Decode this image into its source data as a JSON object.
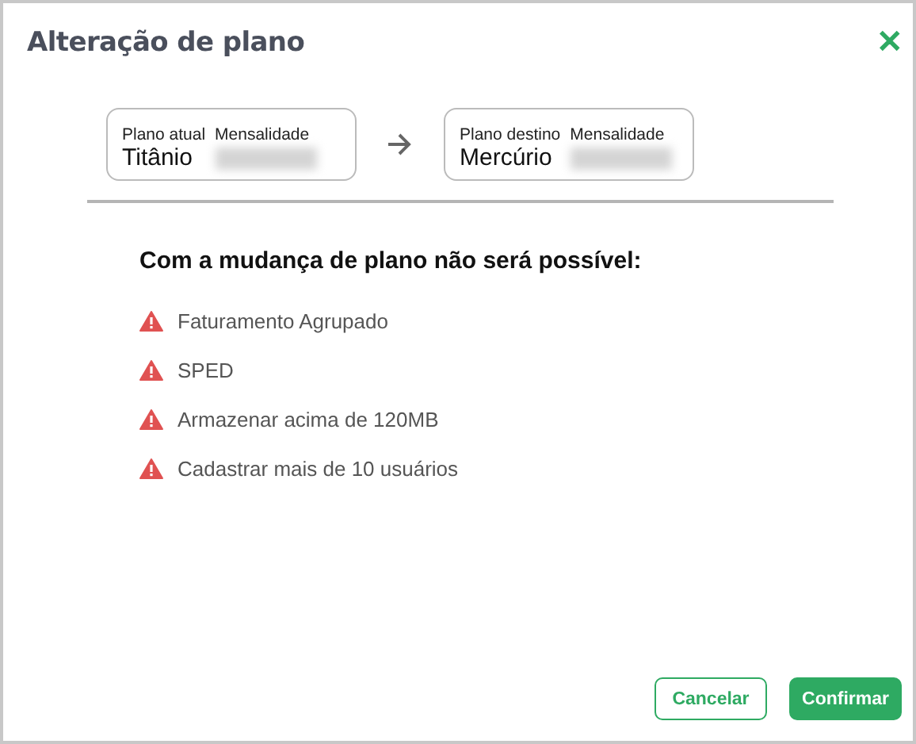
{
  "dialog": {
    "title": "Alteração de plano",
    "close": "✕"
  },
  "plans": [
    {
      "label": "Plano atual",
      "name": "Titânio",
      "price_label": "Mensalidade"
    },
    {
      "label": "Plano destino",
      "name": "Mercúrio",
      "price_label": "Mensalidade"
    }
  ],
  "warning": {
    "heading": "Com a mudança de plano não será possível:",
    "items": [
      "Faturamento Agrupado",
      "SPED",
      "Armazenar acima de 120MB",
      "Cadastrar mais de 10 usuários"
    ]
  },
  "buttons": [
    {
      "label": "Cancelar",
      "kind": "secondary"
    },
    {
      "label": "Confirmar",
      "kind": "primary"
    }
  ]
}
